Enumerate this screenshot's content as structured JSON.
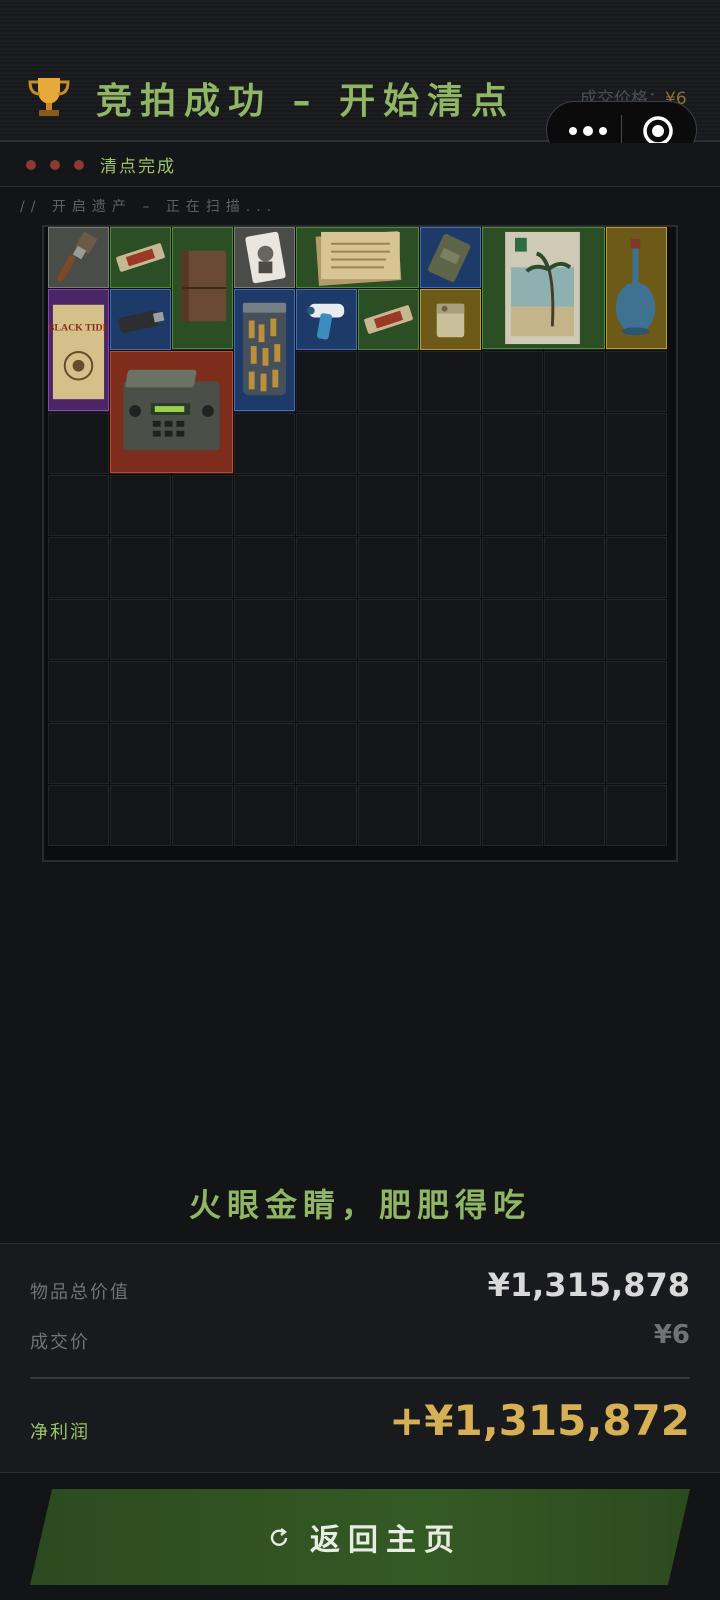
{
  "header": {
    "title": "竞拍成功 – 开始清点",
    "deal_label": "成交价格：",
    "deal_value": "¥6",
    "trophy_icon": "trophy-icon"
  },
  "mini_program": {
    "more_icon": "more-dots-icon",
    "close_icon": "target-close-icon"
  },
  "status": {
    "text": "清点完成",
    "scan_text": "// 开启遗产 – 正在扫描..."
  },
  "inventory": {
    "items": [
      {
        "name": "paint-brush",
        "rarity": "gray",
        "icon": "paintbrush-icon"
      },
      {
        "name": "energy-bar",
        "rarity": "green",
        "icon": "bar-icon"
      },
      {
        "name": "leather-notebook",
        "rarity": "green",
        "icon": "notebook-icon"
      },
      {
        "name": "playing-card",
        "rarity": "gray",
        "icon": "card-icon"
      },
      {
        "name": "old-papers",
        "rarity": "green",
        "icon": "papers-icon"
      },
      {
        "name": "ration-pack",
        "rarity": "blue",
        "icon": "pack-icon"
      },
      {
        "name": "beach-poster",
        "rarity": "green",
        "icon": "poster-icon"
      },
      {
        "name": "blue-decanter",
        "rarity": "gold",
        "icon": "decanter-icon"
      },
      {
        "name": "black-tide-magazine",
        "rarity": "purple",
        "icon": "magazine-icon",
        "label": "BLACK TIDE"
      },
      {
        "name": "usb-drive",
        "rarity": "blue",
        "icon": "usb-icon"
      },
      {
        "name": "ammo-jar",
        "rarity": "blue",
        "icon": "ammo-jar-icon"
      },
      {
        "name": "ir-thermometer",
        "rarity": "blue",
        "icon": "thermometer-icon"
      },
      {
        "name": "energy-bar-2",
        "rarity": "green",
        "icon": "bar-icon"
      },
      {
        "name": "lighter",
        "rarity": "gold",
        "icon": "lighter-icon"
      },
      {
        "name": "field-radio",
        "rarity": "red",
        "icon": "radio-icon"
      }
    ]
  },
  "slogan": "火眼金睛，肥肥得吃",
  "summary": {
    "total_label": "物品总价值",
    "total_value": "¥1,315,878",
    "price_label": "成交价",
    "price_value": "¥6",
    "profit_label": "净利润",
    "profit_value": "+¥1,315,872"
  },
  "home_button": {
    "label": "返回主页",
    "icon": "refresh-icon"
  },
  "colors": {
    "accent_green": "#8fb565",
    "profit_gold": "#d7b055",
    "gray": "#4a4c48",
    "green": "#2b4e24",
    "blue": "#1e3a68",
    "purple": "#4b2566",
    "gold": "#6e5a18",
    "red": "#7e2c1c"
  }
}
